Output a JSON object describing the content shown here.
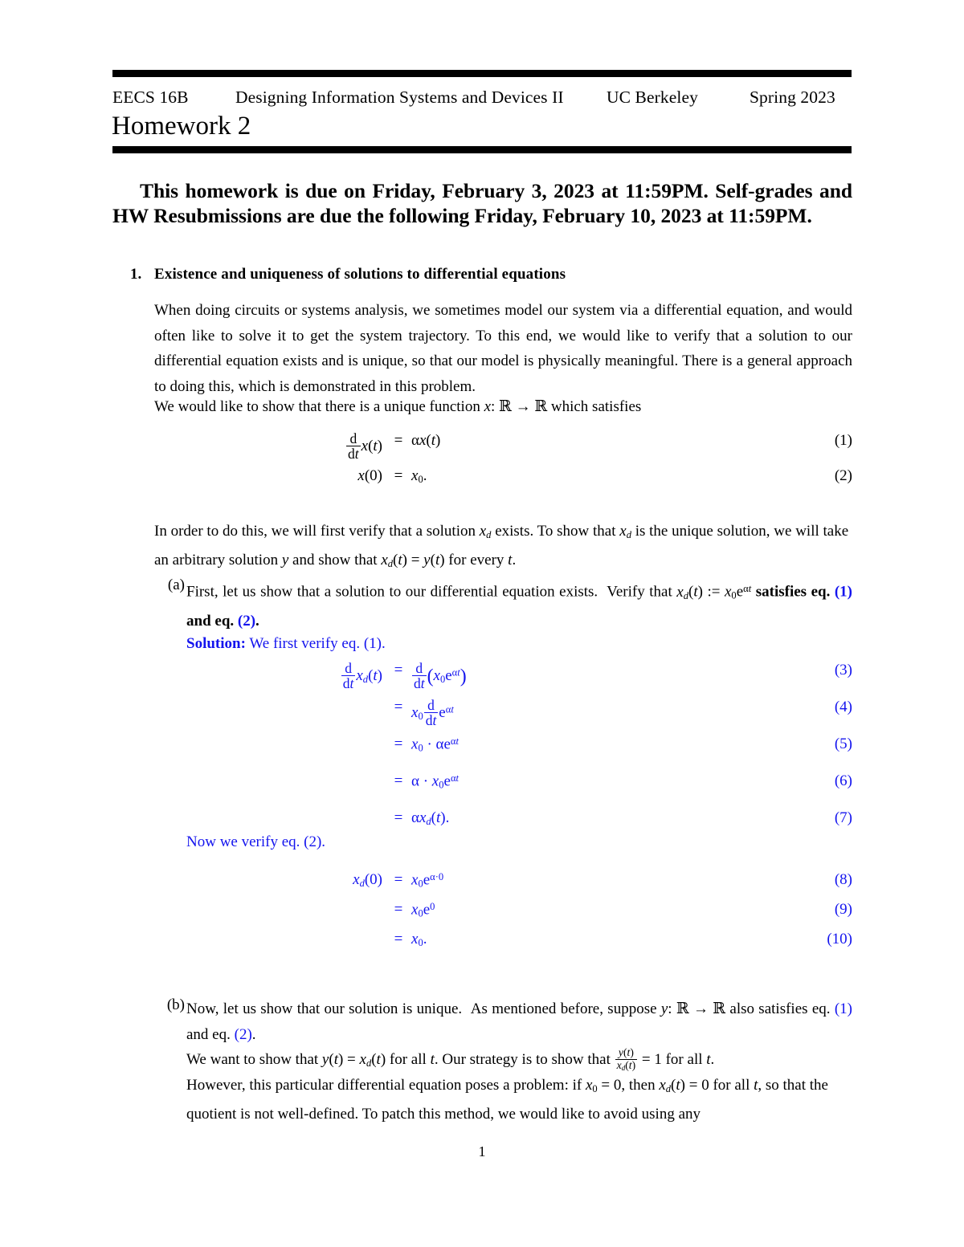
{
  "header": {
    "course": "EECS 16B",
    "course_title": "Designing Information Systems and Devices II",
    "school": "UC Berkeley",
    "term": "Spring 2023",
    "assignment": "Homework 2"
  },
  "due_notice": "This homework is due on Friday, February 3, 2023 at 11:59PM. Self-grades and HW Resubmissions are due the following Friday, February 10, 2023 at 11:59PM.",
  "problem": {
    "number": "1.",
    "title": "Existence and uniqueness of solutions to differential equations",
    "intro_paragraph": "When doing circuits or systems analysis, we sometimes model our system via a differential equation, and would often like to solve it to get the system trajectory. To this end, we would like to verify that a solution to our differential equation exists and is unique, so that our model is physically meaningful. There is a general approach to doing this, which is demonstrated in this problem.",
    "setup_paragraph": "We would like to show that there is a unique function x : ℝ → ℝ which satisfies",
    "plan_paragraph": "In order to do this, we will first verify that a solution x_d exists. To show that x_d is the unique solution, we will take an arbitrary solution y and show that x_d(t) = y(t) for every t."
  },
  "equations": {
    "main": [
      {
        "lhs": "d/dt x(t)",
        "rel": "=",
        "rhs": "αx(t)",
        "tag": "(1)"
      },
      {
        "lhs": "x(0)",
        "rel": "=",
        "rhs": "x₀.",
        "tag": "(2)"
      }
    ],
    "solution_a1": [
      {
        "lhs": "d/dt x_d(t)",
        "rel": "=",
        "rhs": "d/dt (x₀e^{αt})",
        "tag": "(3)"
      },
      {
        "lhs": "",
        "rel": "=",
        "rhs": "x₀ d/dt e^{αt}",
        "tag": "(4)"
      },
      {
        "lhs": "",
        "rel": "=",
        "rhs": "x₀ · αe^{αt}",
        "tag": "(5)"
      },
      {
        "lhs": "",
        "rel": "=",
        "rhs": "α · x₀e^{αt}",
        "tag": "(6)"
      },
      {
        "lhs": "",
        "rel": "=",
        "rhs": "αx_d(t).",
        "tag": "(7)"
      }
    ],
    "solution_a2": [
      {
        "lhs": "x_d(0)",
        "rel": "=",
        "rhs": "x₀e^{α·0}",
        "tag": "(8)"
      },
      {
        "lhs": "",
        "rel": "=",
        "rhs": "x₀e^{0}",
        "tag": "(9)"
      },
      {
        "lhs": "",
        "rel": "=",
        "rhs": "x₀.",
        "tag": "(10)"
      }
    ]
  },
  "parts": {
    "a": {
      "label": "(a)",
      "statement": "First, let us show that a solution to our differential equation exists. Verify that x_d(t) := x₀e^{αt} satisfies eq. (1) and eq. (2).",
      "solution_heading": "Solution:",
      "solution_intro": "We first verify eq. (1).",
      "verify_second": "Now we verify eq. (2)."
    },
    "b": {
      "label": "(b)",
      "statement": "Now, let us show that our solution is unique. As mentioned before, suppose y : ℝ → ℝ also satisfies eq. (1) and eq. (2).",
      "line3": "We want to show that y(t) = x_d(t) for all t. Our strategy is to show that y(t)/x_d(t) = 1 for all t.",
      "line4": "However, this particular differential equation poses a problem: if x₀ = 0, then x_d(t) = 0 for all t, so that the quotient is not well-defined. To patch this method, we would like to avoid using any"
    }
  },
  "footer": {
    "page_number": "1"
  },
  "colors": {
    "solution_blue": "#1414ee",
    "text_black": "#000000",
    "rule_black": "#000000"
  }
}
